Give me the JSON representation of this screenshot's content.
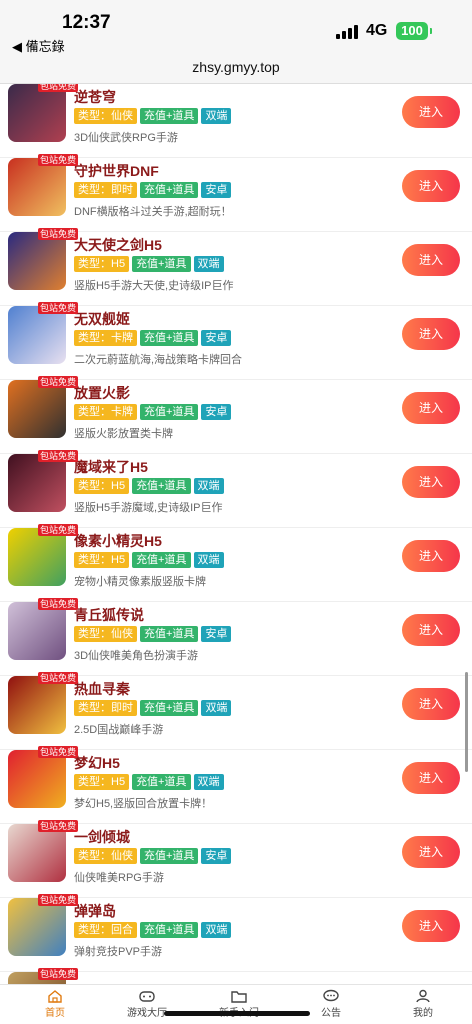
{
  "status_bar": {
    "time": "12:37",
    "back_app": "◀ 備忘錄",
    "network": "4G",
    "battery": "100"
  },
  "url": "zhsy.gmyy.top",
  "games": [
    {
      "name": "逆苍穹",
      "badge": "包站免费",
      "tags": [
        "类型：仙侠",
        "充值+道具",
        "双端"
      ],
      "desc": "3D仙侠武侠RPG手游",
      "button": "进入",
      "colors": [
        "#3a2a4a",
        "#b04050"
      ]
    },
    {
      "name": "守护世界DNF",
      "badge": "包站免费",
      "tags": [
        "类型：即时",
        "充值+道具",
        "安卓"
      ],
      "desc": "DNF横版格斗过关手游,超耐玩！",
      "button": "进入",
      "colors": [
        "#c83020",
        "#f0c060"
      ]
    },
    {
      "name": "大天使之剑H5",
      "badge": "包站免费",
      "tags": [
        "类型：H5",
        "充值+道具",
        "双端"
      ],
      "desc": "竖版H5手游大天使,史诗级IP巨作",
      "button": "进入",
      "colors": [
        "#2a2a80",
        "#e08030"
      ]
    },
    {
      "name": "无双舰姬",
      "badge": "包站免费",
      "tags": [
        "类型：卡牌",
        "充值+道具",
        "安卓"
      ],
      "desc": "二次元蔚蓝航海,海战策略卡牌回合",
      "button": "进入",
      "colors": [
        "#5080d0",
        "#e8e0f0"
      ]
    },
    {
      "name": "放置火影",
      "badge": "包站免费",
      "tags": [
        "类型：卡牌",
        "充值+道具",
        "安卓"
      ],
      "desc": "竖版火影放置类卡牌",
      "button": "进入",
      "colors": [
        "#e07020",
        "#303030"
      ]
    },
    {
      "name": "魔域来了H5",
      "badge": "包站免费",
      "tags": [
        "类型：H5",
        "充值+道具",
        "双端"
      ],
      "desc": "竖版H5手游魔域,史诗级IP巨作",
      "button": "进入",
      "colors": [
        "#401020",
        "#c05060"
      ]
    },
    {
      "name": "像素小精灵H5",
      "badge": "包站免费",
      "tags": [
        "类型：H5",
        "充值+道具",
        "双端"
      ],
      "desc": "宠物小精灵像素版竖版卡牌",
      "button": "进入",
      "colors": [
        "#f0d000",
        "#40a060"
      ]
    },
    {
      "name": "青丘狐传说",
      "badge": "包站免费",
      "tags": [
        "类型：仙侠",
        "充值+道具",
        "安卓"
      ],
      "desc": "3D仙侠唯美角色扮演手游",
      "button": "进入",
      "colors": [
        "#d0c0d8",
        "#705080"
      ]
    },
    {
      "name": "热血寻秦",
      "badge": "包站免费",
      "tags": [
        "类型：即时",
        "充值+道具",
        "双端"
      ],
      "desc": "2.5D国战巅峰手游",
      "button": "进入",
      "colors": [
        "#901010",
        "#f0c040"
      ]
    },
    {
      "name": "梦幻H5",
      "badge": "包站免费",
      "tags": [
        "类型：H5",
        "充值+道具",
        "双端"
      ],
      "desc": "梦幻H5,竖版回合放置卡牌！",
      "button": "进入",
      "colors": [
        "#e02030",
        "#f0b020"
      ]
    },
    {
      "name": "一剑倾城",
      "badge": "包站免费",
      "tags": [
        "类型：仙侠",
        "充值+道具",
        "安卓"
      ],
      "desc": "仙侠唯美RPG手游",
      "button": "进入",
      "colors": [
        "#e8d8d0",
        "#b03040"
      ]
    },
    {
      "name": "弹弹岛",
      "badge": "包站免费",
      "tags": [
        "类型：回合",
        "充值+道具",
        "双端"
      ],
      "desc": "弹射竞技PVP手游",
      "button": "进入",
      "colors": [
        "#f0c040",
        "#4080c0"
      ]
    },
    {
      "name": "",
      "badge": "包站免费",
      "tags": [],
      "desc": "",
      "button": "",
      "colors": [
        "#c0a060",
        "#704020"
      ]
    }
  ],
  "tab_bar": {
    "items": [
      {
        "label": "首页",
        "icon": "home-icon",
        "active": true
      },
      {
        "label": "游戏大厅",
        "icon": "gamepad-icon",
        "active": false
      },
      {
        "label": "新手入门",
        "icon": "folder-icon",
        "active": false
      },
      {
        "label": "公告",
        "icon": "chat-icon",
        "active": false
      },
      {
        "label": "我的",
        "icon": "user-icon",
        "active": false
      }
    ]
  },
  "theme": {
    "accent": "#e07b10",
    "button_gradient": [
      "#ff7a4a",
      "#f5364a"
    ],
    "badge_red": "#e0202a"
  }
}
